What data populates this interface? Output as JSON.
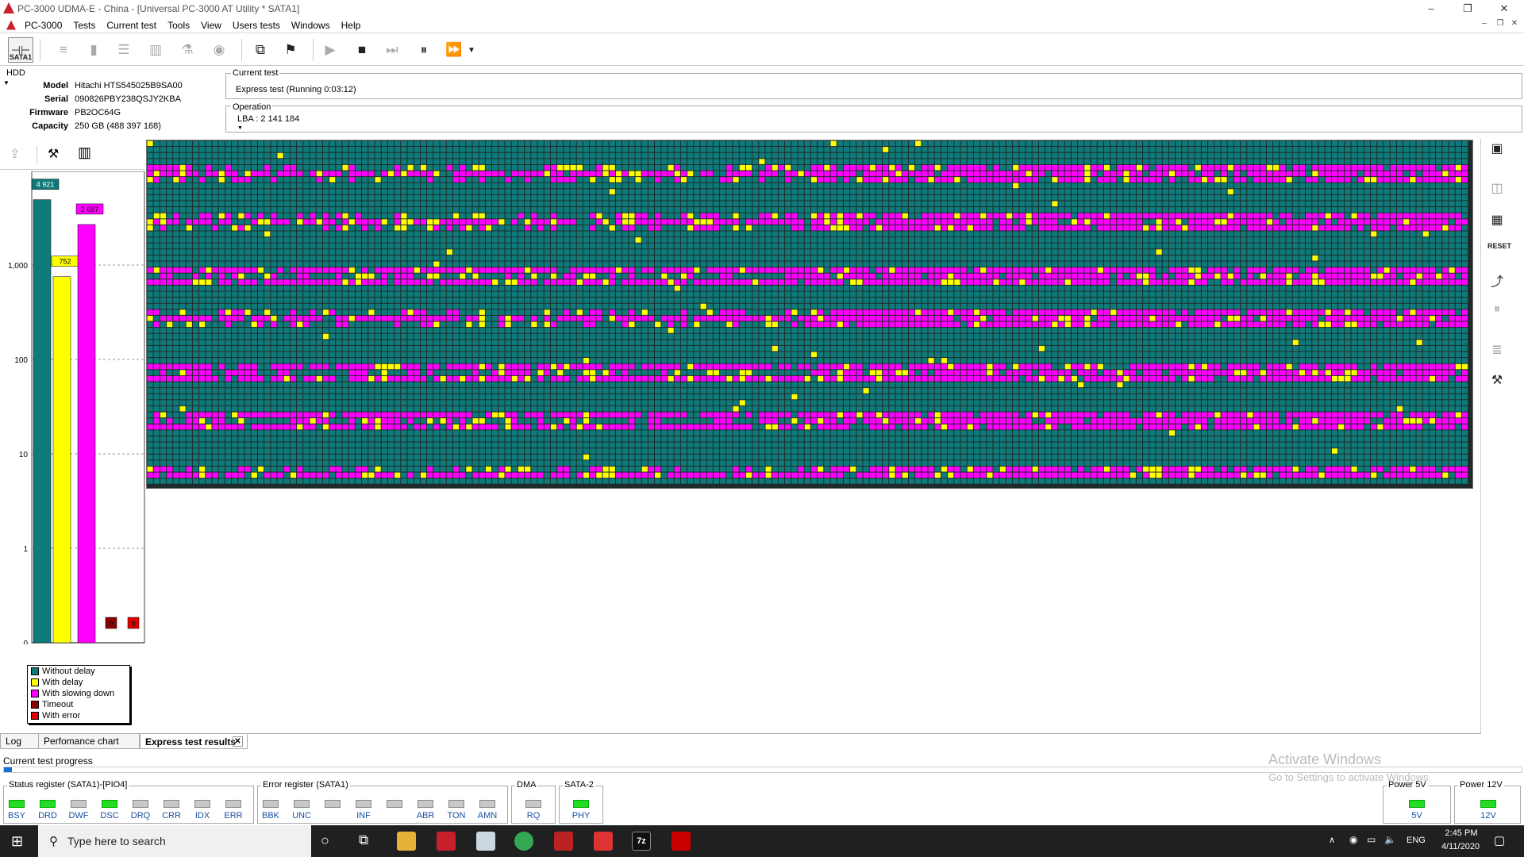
{
  "window": {
    "title": "PC-3000 UDMA-E - China - [Universal PC-3000 AT Utility * SATA1]",
    "minimize": "–",
    "maximize": "❐",
    "close": "✕"
  },
  "menu": [
    "PC-3000",
    "Tests",
    "Current test",
    "Tools",
    "View",
    "Users tests",
    "Windows",
    "Help"
  ],
  "toolbar": {
    "port_label": "SATA1"
  },
  "hdd": {
    "section": "HDD",
    "model_label": "Model",
    "model": "Hitachi HTS545025B9SA00",
    "serial_label": "Serial",
    "serial": "090826PBY238QSJY2KBA",
    "firmware_label": "Firmware",
    "firmware": "PB2OC64G",
    "capacity_label": "Capacity",
    "capacity": "250 GB (488 397 168)"
  },
  "current_test": {
    "label": "Current test",
    "value": "Express test (Running 0:03:12)",
    "operation_label": "Operation",
    "operation": "LBA : 2 141 184"
  },
  "chart_data": {
    "type": "bar",
    "yscale": "log",
    "y_ticks": [
      "0",
      "1",
      "10",
      "100",
      "1,000"
    ],
    "categories": [
      "Without delay",
      "With delay",
      "With slowing down",
      "Timeout",
      "With error"
    ],
    "values": [
      4921,
      752,
      2687,
      0,
      0
    ],
    "value_labels": [
      "4 921",
      "752",
      "2 687",
      "0",
      "0"
    ],
    "colors": [
      "#0f7a7a",
      "#ffff00",
      "#ff00ff",
      "#8b0000",
      "#e00000"
    ],
    "legend_position": "bottom-left"
  },
  "grid": {
    "colors": {
      "without_delay": "#0f7a7a",
      "with_delay": "#ffff00",
      "with_slowing_down": "#ff00ff"
    }
  },
  "tabs": [
    "Log",
    "Perfomance chart",
    "Express test results"
  ],
  "progress": {
    "label": "Current test progress",
    "value_fraction": 0.005
  },
  "status_register": {
    "label": "Status register (SATA1)-[PIO4]",
    "flags": [
      {
        "n": "BSY",
        "on": true
      },
      {
        "n": "DRD",
        "on": true
      },
      {
        "n": "DWF",
        "on": false
      },
      {
        "n": "DSC",
        "on": true
      },
      {
        "n": "DRQ",
        "on": false
      },
      {
        "n": "CRR",
        "on": false
      },
      {
        "n": "IDX",
        "on": false
      },
      {
        "n": "ERR",
        "on": false
      }
    ]
  },
  "error_register": {
    "label": "Error register (SATA1)",
    "flags": [
      {
        "n": "BBK",
        "on": false
      },
      {
        "n": "UNC",
        "on": false
      },
      {
        "n": "",
        "on": false
      },
      {
        "n": "INF",
        "on": false
      },
      {
        "n": "",
        "on": false
      },
      {
        "n": "ABR",
        "on": false
      },
      {
        "n": "TON",
        "on": false
      },
      {
        "n": "AMN",
        "on": false
      }
    ]
  },
  "dma": {
    "label": "DMA",
    "flag": "RQ"
  },
  "sata2": {
    "label": "SATA-2",
    "flag": "PHY"
  },
  "power5": {
    "label": "Power 5V",
    "flag": "5V"
  },
  "power12": {
    "label": "Power 12V",
    "flag": "12V"
  },
  "watermark": {
    "title": "Activate Windows",
    "sub": "Go to Settings to activate Windows."
  },
  "taskbar": {
    "search_placeholder": "Type here to search",
    "lang": "ENG",
    "time": "2:45 PM",
    "date": "4/11/2020"
  }
}
